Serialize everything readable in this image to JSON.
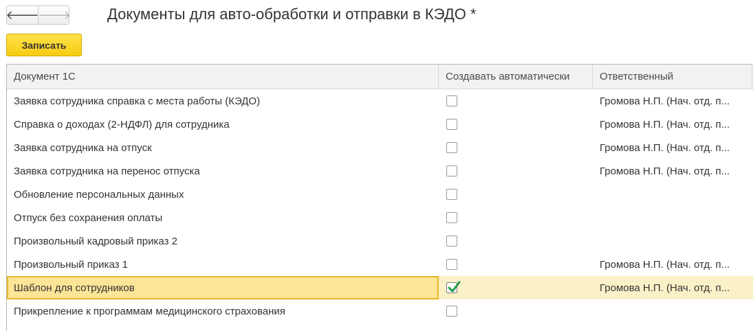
{
  "toolbar": {
    "back_icon": "arrow-left-icon",
    "forward_icon": "arrow-right-icon",
    "back_glyph": "🡐",
    "forward_glyph": "🡒",
    "save_label": "Записать"
  },
  "title": "Документы для авто-обработки и отправки в КЭДО *",
  "table": {
    "columns": [
      "Документ 1С",
      "Создавать автоматически",
      "Ответственный"
    ],
    "rows": [
      {
        "document": "Заявка сотрудника справка с места работы (КЭДО)",
        "auto": false,
        "responsible": "Громова Н.П. (Нач. отд. п..."
      },
      {
        "document": "Справка о доходах (2-НДФЛ) для сотрудника",
        "auto": false,
        "responsible": "Громова Н.П. (Нач. отд. п..."
      },
      {
        "document": "Заявка сотрудника на отпуск",
        "auto": false,
        "responsible": "Громова Н.П. (Нач. отд. п..."
      },
      {
        "document": "Заявка сотрудника на перенос отпуска",
        "auto": false,
        "responsible": "Громова Н.П. (Нач. отд. п..."
      },
      {
        "document": "Обновление персональных данных",
        "auto": false,
        "responsible": ""
      },
      {
        "document": "Отпуск без сохранения оплаты",
        "auto": false,
        "responsible": ""
      },
      {
        "document": "Произвольный кадровый приказ 2",
        "auto": false,
        "responsible": ""
      },
      {
        "document": "Произвольный приказ 1",
        "auto": false,
        "responsible": "Громова Н.П. (Нач. отд. п..."
      },
      {
        "document": "Шаблон для сотрудников",
        "auto": true,
        "responsible": "Громова Н.П. (Нач. отд. п...",
        "selected": true
      },
      {
        "document": "Прикрепление к программам медицинского страхования",
        "auto": false,
        "responsible": ""
      }
    ]
  },
  "colors": {
    "accent": "#f6cc12",
    "selected_row": "#fbf1c8",
    "selected_cell": "#fde597",
    "check": "#1f9a4a"
  }
}
